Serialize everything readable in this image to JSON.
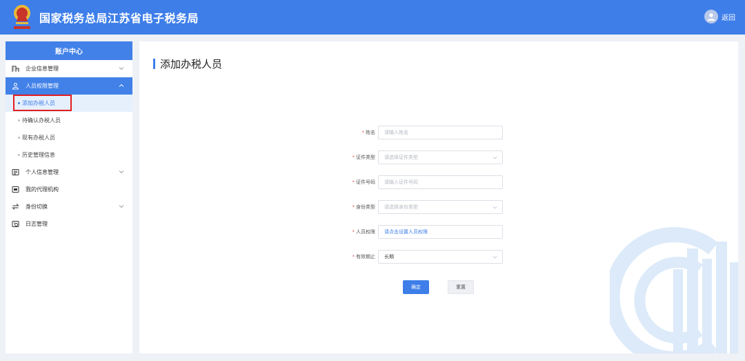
{
  "header": {
    "title": "国家税务总局江苏省电子税务局",
    "user_name": "返回",
    "colors": {
      "brand": "#3d7ee9",
      "emblem_red": "#c8332a",
      "emblem_gold": "#e8b93a"
    }
  },
  "sidebar": {
    "title": "账户中心",
    "menu": [
      {
        "label": "企业信息管理",
        "icon": "building-icon",
        "expandable": true
      },
      {
        "label": "人员权限管理",
        "icon": "user-group-icon",
        "expandable": true,
        "expanded": true,
        "children": [
          "添加办税人员",
          "待确认办税人员",
          "现有办税人员",
          "历史管理信息"
        ]
      },
      {
        "label": "个人信息管理",
        "icon": "profile-card-icon",
        "expandable": true
      },
      {
        "label": "我的代理机构",
        "icon": "agency-icon",
        "expandable": false
      },
      {
        "label": "身份切换",
        "icon": "switch-icon",
        "expandable": true
      },
      {
        "label": "日志管理",
        "icon": "log-icon",
        "expandable": false
      }
    ],
    "selected_child": "添加办税人员"
  },
  "main": {
    "page_title": "添加办税人员",
    "form": {
      "fields": [
        {
          "label": "姓名",
          "placeholder": "请输入姓名",
          "type": "text",
          "value": ""
        },
        {
          "label": "证件类型",
          "placeholder": "请选择证件类型",
          "type": "select",
          "value": ""
        },
        {
          "label": "证件号码",
          "placeholder": "请输入证件号码",
          "type": "text",
          "value": ""
        },
        {
          "label": "身份类型",
          "placeholder": "请选择身份类型",
          "type": "select",
          "value": ""
        },
        {
          "label": "人员权限",
          "placeholder": "",
          "type": "link",
          "value": "请点击设置人员权限"
        },
        {
          "label": "有效期止",
          "placeholder": "",
          "type": "select",
          "value": "长期"
        }
      ],
      "required_mark": "*",
      "confirm_label": "确定",
      "reset_label": "重置"
    }
  }
}
